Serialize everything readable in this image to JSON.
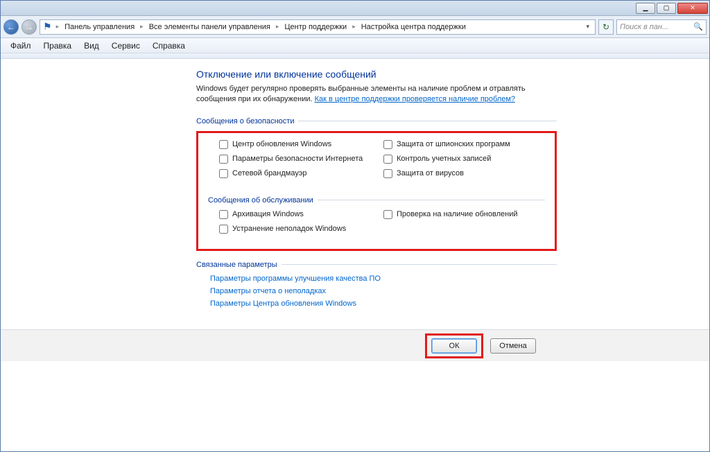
{
  "titlebar": {},
  "nav": {
    "breadcrumbs": [
      "Панель управления",
      "Все элементы панели управления",
      "Центр поддержки",
      "Настройка центра поддержки"
    ]
  },
  "search": {
    "placeholder": "Поиск в пан..."
  },
  "menu": {
    "file": "Файл",
    "edit": "Правка",
    "view": "Вид",
    "tools": "Сервис",
    "help": "Справка"
  },
  "page": {
    "heading": "Отключение или включение сообщений",
    "desc_prefix": "Windows будет регулярно проверять выбранные элементы на наличие проблем и отравлять сообщения при их обнаружении. ",
    "desc_link": "Как в центре поддержки проверяется наличие проблем?"
  },
  "groups": {
    "security": {
      "title": "Сообщения о безопасности",
      "items_left": [
        "Центр обновления Windows",
        "Параметры безопасности Интернета",
        "Сетевой брандмауэр"
      ],
      "items_right": [
        "Защита от шпионских программ",
        "Контроль учетных записей",
        "Защита от вирусов"
      ]
    },
    "maintenance": {
      "title": "Сообщения об обслуживании",
      "items_left": [
        "Архивация Windows",
        "Устранение неполадок Windows"
      ],
      "items_right": [
        "Проверка на наличие обновлений"
      ]
    }
  },
  "related": {
    "title": "Связанные параметры",
    "links": [
      "Параметры программы улучшения качества ПО",
      "Параметры отчета о неполадках",
      "Параметры Центра обновления Windows"
    ]
  },
  "buttons": {
    "ok": "ОК",
    "cancel": "Отмена"
  }
}
